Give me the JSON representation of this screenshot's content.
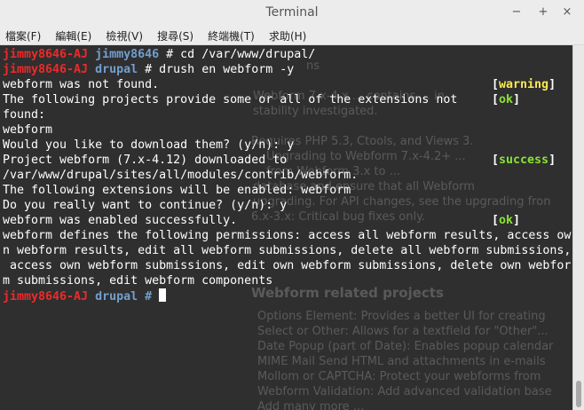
{
  "window": {
    "title": "Terminal",
    "controls": {
      "minimize": "−",
      "maximize": "+",
      "close": "×"
    }
  },
  "menu": [
    "檔案(F)",
    "編輯(E)",
    "檢視(V)",
    "搜尋(S)",
    "終端機(T)",
    "求助(H)"
  ],
  "terminal": {
    "lines": [
      {
        "user": "jimmy8646-AJ",
        "path": "jimmy8646",
        "cmd": " # cd /var/www/drupal/"
      },
      {
        "user": "jimmy8646-AJ",
        "path": "drupal",
        "cmd": " # drush en webform -y"
      },
      {
        "text": "webform was not found.",
        "tag": "warning"
      },
      {
        "text": "The following projects provide some or all of the extensions not",
        "tag": "ok"
      },
      {
        "text": "found:"
      },
      {
        "text": "webform"
      },
      {
        "text": "Would you like to download them? (y/n): y"
      },
      {
        "text": "Project webform (7.x-4.12) downloaded to",
        "tag": "success"
      },
      {
        "text": "/var/www/drupal/sites/all/modules/contrib/webform."
      },
      {
        "text": "The following extensions will be enabled: webform"
      },
      {
        "text": "Do you really want to continue? (y/n): y"
      },
      {
        "text": "webform was enabled successfully.",
        "tag": "ok"
      },
      {
        "text": "webform defines the following permissions: access all webform results, access ow"
      },
      {
        "text": "n webform results, edit all webform submissions, delete all webform submissions,"
      },
      {
        "text": " access own webform submissions, edit own webform submissions, delete own webfor"
      },
      {
        "text": "m submissions, edit webform components"
      },
      {
        "user": "jimmy8646-AJ",
        "path": "drupal",
        "cmd": " # ",
        "cursor": true
      }
    ],
    "background_doc": [
      "ns",
      "Webform 7.x-4.x ... contains ... in",
      "stability investigated.",
      "Requires PHP 5.3, Ctools, and Views 3.",
      "Upgrading to Webform 7.x-4.2+ ...",
      "from Webform 3.x to ...",
      "database and ensure that all Webform",
      "upgrading. For API changes, see the upgrading fron",
      "6.x-3.x: Critical bug fixes only.",
      "Webform related projects",
      "Options Element: Provides a better UI for creating",
      "Select or Other: Allows for a textfield for \"Other\"...",
      "Date Popup (part of Date): Enables popup calendar",
      "MIME Mail Send HTML and attachments in e-mails",
      "Mollom or CAPTCHA: Protect your webforms from",
      "Webform Validation: Add advanced validation base",
      "Add many more ..."
    ]
  }
}
